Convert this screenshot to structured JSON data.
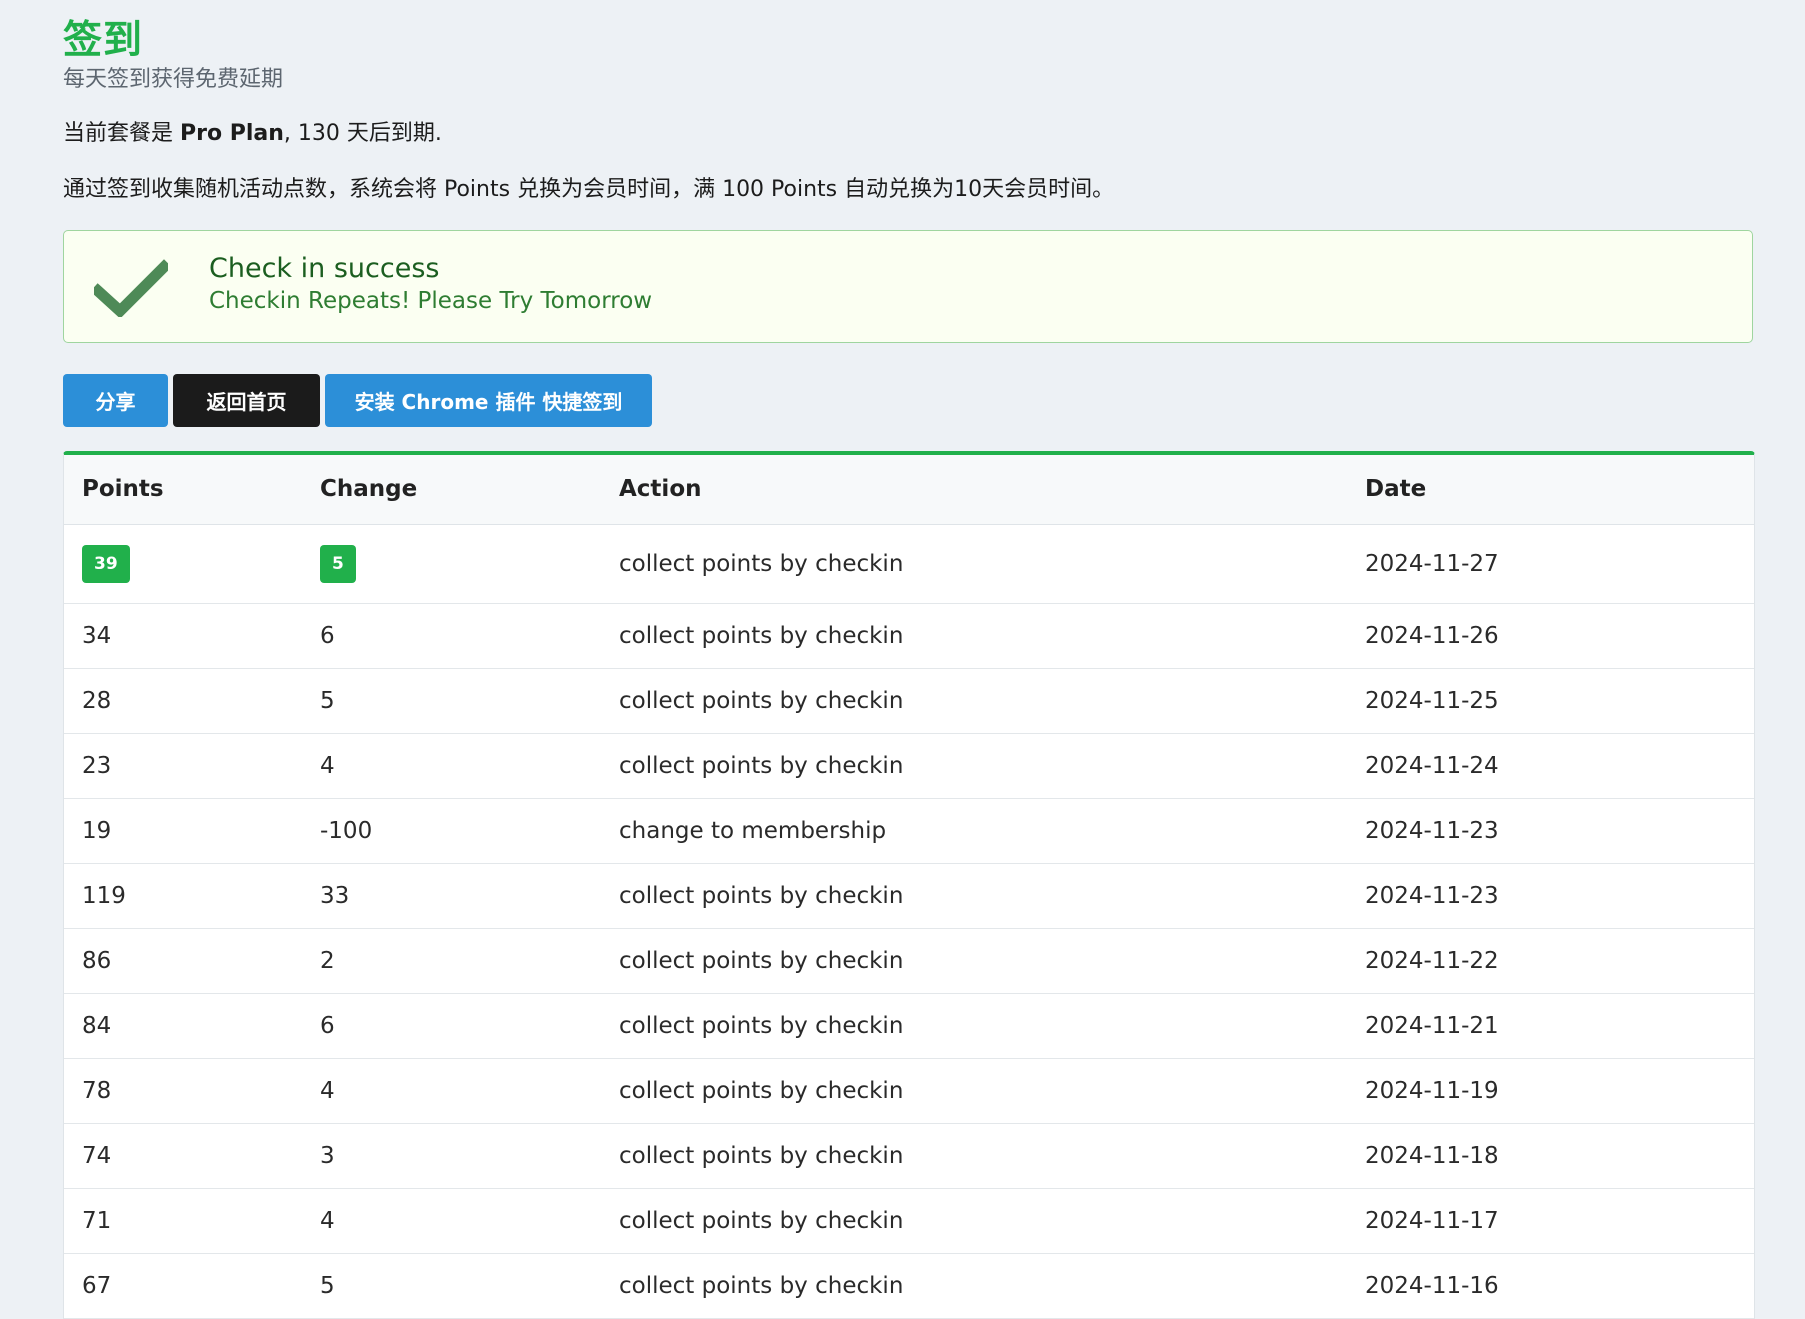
{
  "header": {
    "title": "签到",
    "subtitle": "每天签到获得免费延期"
  },
  "plan": {
    "prefix": "当前套餐是 ",
    "name": "Pro Plan",
    "suffix": ", 130 天后到期."
  },
  "description": "通过签到收集随机活动点数，系统会将 Points 兑换为会员时间，满 100 Points 自动兑换为10天会员时间。",
  "alert": {
    "title": "Check in success",
    "message": "Checkin Repeats! Please Try Tomorrow",
    "icon": "checkmark-icon",
    "color": "#4e8a57"
  },
  "buttons": {
    "share": "分享",
    "home": "返回首页",
    "install": "安装 Chrome 插件 快捷签到"
  },
  "table": {
    "headers": [
      "Points",
      "Change",
      "Action",
      "Date"
    ],
    "rows": [
      {
        "points": "39",
        "change": "5",
        "action": "collect points by checkin",
        "date": "2024-11-27"
      },
      {
        "points": "34",
        "change": "6",
        "action": "collect points by checkin",
        "date": "2024-11-26"
      },
      {
        "points": "28",
        "change": "5",
        "action": "collect points by checkin",
        "date": "2024-11-25"
      },
      {
        "points": "23",
        "change": "4",
        "action": "collect points by checkin",
        "date": "2024-11-24"
      },
      {
        "points": "19",
        "change": "-100",
        "action": "change to membership",
        "date": "2024-11-23"
      },
      {
        "points": "119",
        "change": "33",
        "action": "collect points by checkin",
        "date": "2024-11-23"
      },
      {
        "points": "86",
        "change": "2",
        "action": "collect points by checkin",
        "date": "2024-11-22"
      },
      {
        "points": "84",
        "change": "6",
        "action": "collect points by checkin",
        "date": "2024-11-21"
      },
      {
        "points": "78",
        "change": "4",
        "action": "collect points by checkin",
        "date": "2024-11-19"
      },
      {
        "points": "74",
        "change": "3",
        "action": "collect points by checkin",
        "date": "2024-11-18"
      },
      {
        "points": "71",
        "change": "4",
        "action": "collect points by checkin",
        "date": "2024-11-17"
      },
      {
        "points": "67",
        "change": "5",
        "action": "collect points by checkin",
        "date": "2024-11-16"
      }
    ]
  },
  "colors": {
    "accent": "#21b04b",
    "button_blue": "#2c8fd8",
    "button_dark": "#1b1b1b"
  }
}
